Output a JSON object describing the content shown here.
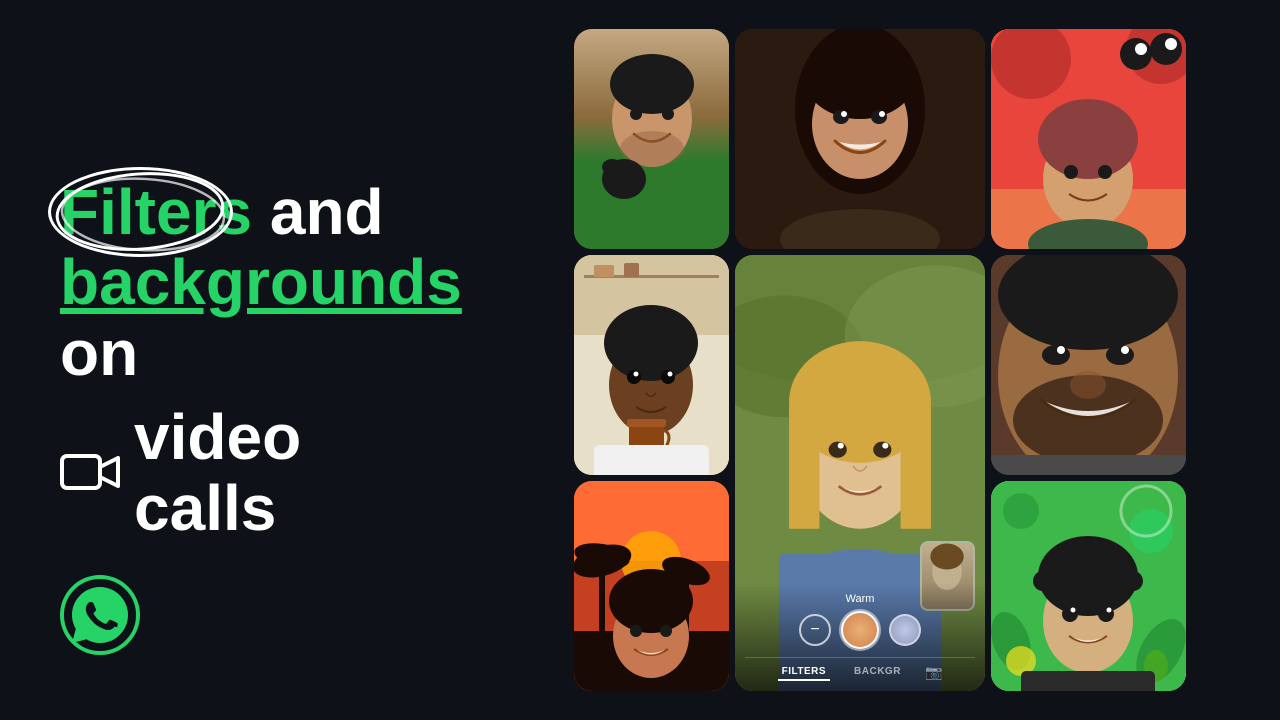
{
  "page": {
    "background_color": "#0e1218",
    "title": "WhatsApp Filters and backgrounds on video calls"
  },
  "left": {
    "headline_line1_part1": "Filters",
    "headline_line1_part2": " and",
    "headline_line2_part1": "backgrounds",
    "headline_line2_part2": " on",
    "headline_line3": "video calls",
    "video_icon": "🎥",
    "whatsapp_logo_alt": "WhatsApp logo"
  },
  "filter_ui": {
    "label": "Warm",
    "tab_filters": "FILTERS",
    "tab_backgr": "BACKGR",
    "tab_camera_icon": "📷"
  },
  "grid": {
    "cells": [
      {
        "id": "cell-1",
        "description": "Man holding dog, green shirt"
      },
      {
        "id": "cell-2",
        "description": "Woman smiling, dark background"
      },
      {
        "id": "cell-3",
        "description": "Woman with cartoon red background"
      },
      {
        "id": "cell-4",
        "description": "Man with coffee cup, café"
      },
      {
        "id": "cell-5",
        "description": "Woman with warm filter applied, main view"
      },
      {
        "id": "cell-6",
        "description": "Man with beard, close-up smiling"
      },
      {
        "id": "cell-7",
        "description": "Woman with palm trees sunset"
      },
      {
        "id": "cell-8",
        "description": "Woman neutral expression"
      },
      {
        "id": "cell-9",
        "description": "Man with illustrated green background"
      }
    ]
  }
}
